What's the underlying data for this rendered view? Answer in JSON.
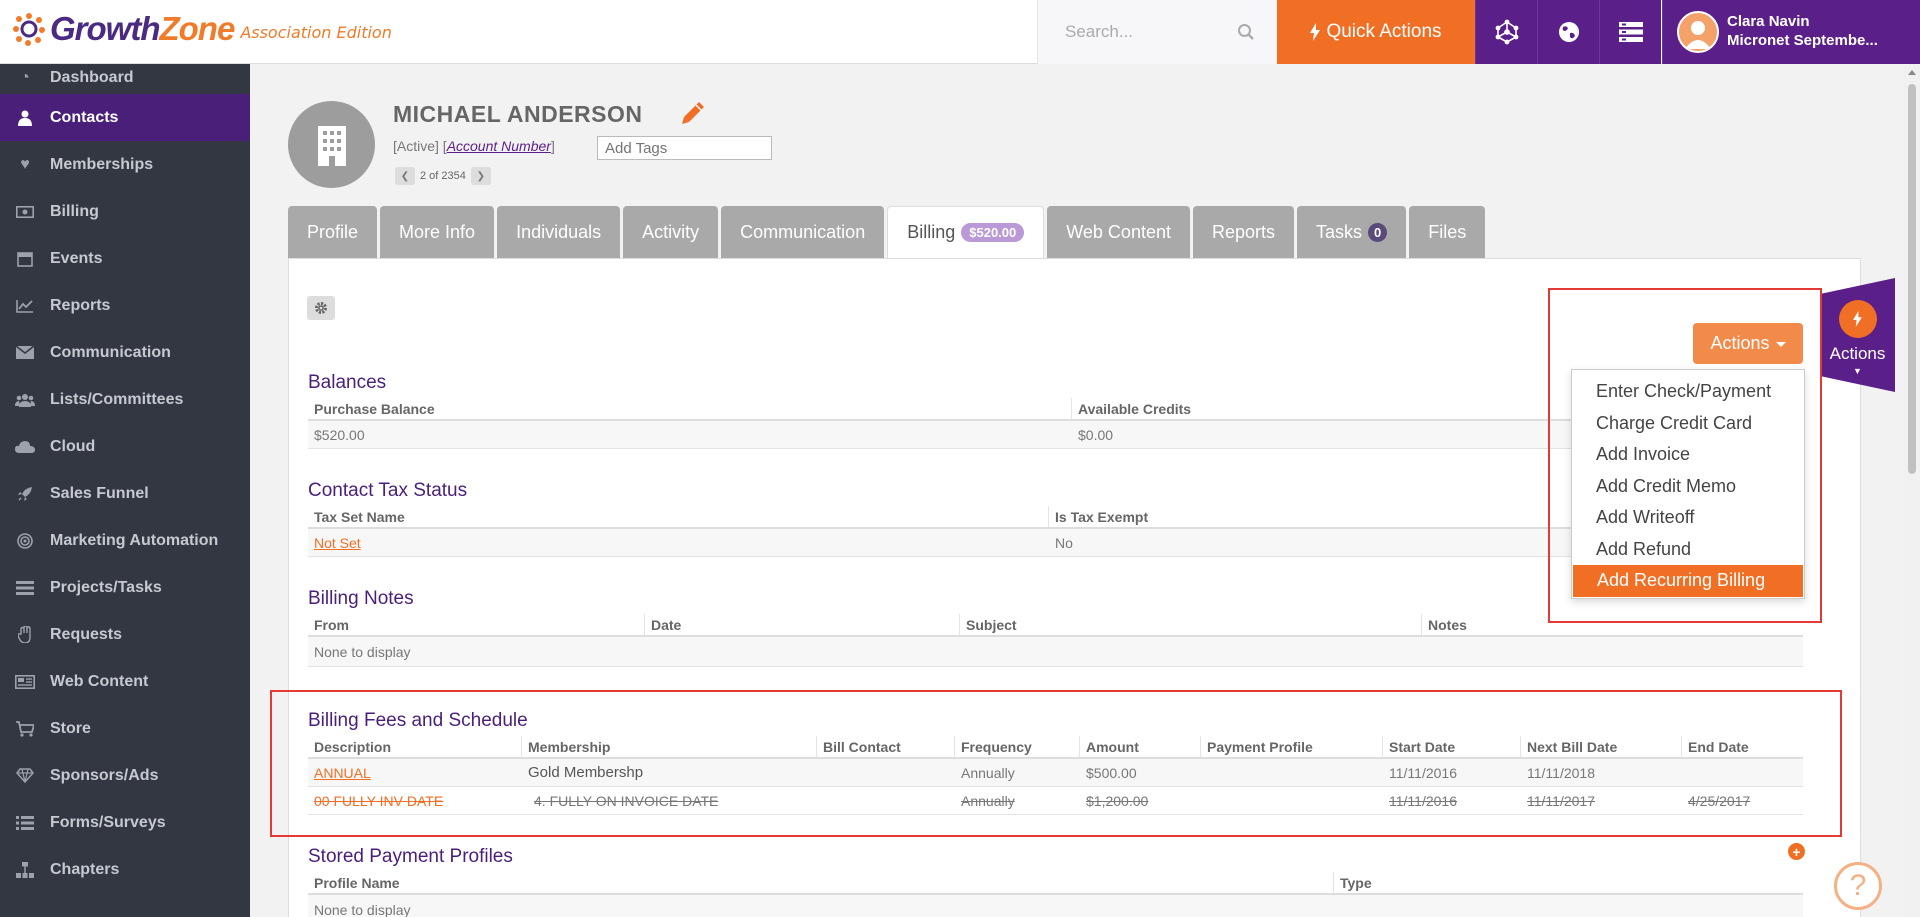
{
  "brand": {
    "name_a": "Growth",
    "name_b": "Zone",
    "edition": "Association Edition"
  },
  "search": {
    "placeholder": "Search..."
  },
  "quick_actions": {
    "label": "Quick Actions"
  },
  "user": {
    "name": "Clara Navin",
    "org": "Micronet Septembe..."
  },
  "sidebar": {
    "items": [
      {
        "label": "Dashboard",
        "icon": "dashboard-icon"
      },
      {
        "label": "Contacts",
        "icon": "user-icon",
        "active": true
      },
      {
        "label": "Memberships",
        "icon": "heart-icon"
      },
      {
        "label": "Billing",
        "icon": "money-icon"
      },
      {
        "label": "Events",
        "icon": "calendar-icon"
      },
      {
        "label": "Reports",
        "icon": "line-chart-icon"
      },
      {
        "label": "Communication",
        "icon": "envelope-icon"
      },
      {
        "label": "Lists/Committees",
        "icon": "users-icon"
      },
      {
        "label": "Cloud",
        "icon": "cloud-icon"
      },
      {
        "label": "Sales Funnel",
        "icon": "rocket-icon"
      },
      {
        "label": "Marketing Automation",
        "icon": "bullseye-icon"
      },
      {
        "label": "Projects/Tasks",
        "icon": "tasks-icon"
      },
      {
        "label": "Requests",
        "icon": "hand-icon"
      },
      {
        "label": "Web Content",
        "icon": "newspaper-icon"
      },
      {
        "label": "Store",
        "icon": "cart-icon"
      },
      {
        "label": "Sponsors/Ads",
        "icon": "diamond-icon"
      },
      {
        "label": "Forms/Surveys",
        "icon": "list-icon"
      },
      {
        "label": "Chapters",
        "icon": "sitemap-icon"
      }
    ]
  },
  "contact": {
    "name": "MICHAEL ANDERSON",
    "status": "[Active]",
    "account_link": "Account Number",
    "tags_placeholder": "Add Tags",
    "pager": "2 of 2354"
  },
  "tabs": [
    {
      "label": "Profile"
    },
    {
      "label": "More Info"
    },
    {
      "label": "Individuals"
    },
    {
      "label": "Activity"
    },
    {
      "label": "Communication"
    },
    {
      "label": "Billing",
      "badge": "$520.00",
      "active": true
    },
    {
      "label": "Web Content"
    },
    {
      "label": "Reports"
    },
    {
      "label": "Tasks",
      "badge": "0"
    },
    {
      "label": "Files"
    }
  ],
  "balances": {
    "title": "Balances",
    "headers": [
      "Purchase Balance",
      "Available Credits"
    ],
    "row": [
      "$520.00",
      "$0.00"
    ]
  },
  "tax": {
    "title": "Contact Tax Status",
    "headers": [
      "Tax Set Name",
      "Is Tax Exempt"
    ],
    "row": [
      "Not Set",
      "No"
    ]
  },
  "notes": {
    "title": "Billing Notes",
    "headers": [
      "From",
      "Date",
      "Subject",
      "Notes"
    ],
    "empty": "None to display"
  },
  "fees": {
    "title": "Billing Fees and Schedule",
    "headers": [
      "Description",
      "Membership",
      "Bill Contact",
      "Frequency",
      "Amount",
      "Payment Profile",
      "Start Date",
      "Next Bill Date",
      "End Date"
    ],
    "rows": [
      [
        "ANNUAL",
        "Gold Membershp",
        "",
        "Annually",
        "$500.00",
        "",
        "11/11/2016",
        "11/11/2018",
        ""
      ],
      [
        "00 FULLY INV DATE",
        "4. FULLY ON INVOICE DATE",
        "",
        "Annually",
        "$1,200.00",
        "",
        "11/11/2016",
        "11/11/2017",
        "4/25/2017"
      ]
    ]
  },
  "payment_profiles": {
    "title": "Stored Payment Profiles",
    "headers": [
      "Profile Name",
      "Type"
    ],
    "empty": "None to display"
  },
  "actions": {
    "button_label": "Actions",
    "menu": [
      "Enter Check/Payment",
      "Charge Credit Card",
      "Add Invoice",
      "Add Credit Memo",
      "Add Writeoff",
      "Add Refund",
      "Add Recurring Billing"
    ],
    "highlighted": "Add Recurring Billing",
    "side_label": "Actions"
  },
  "help": {
    "label": "?"
  },
  "colors": {
    "accent": "#f06f24",
    "brand_purple": "#5b1f8a",
    "sidebar": "#323742",
    "highlight_box": "#e53935"
  }
}
